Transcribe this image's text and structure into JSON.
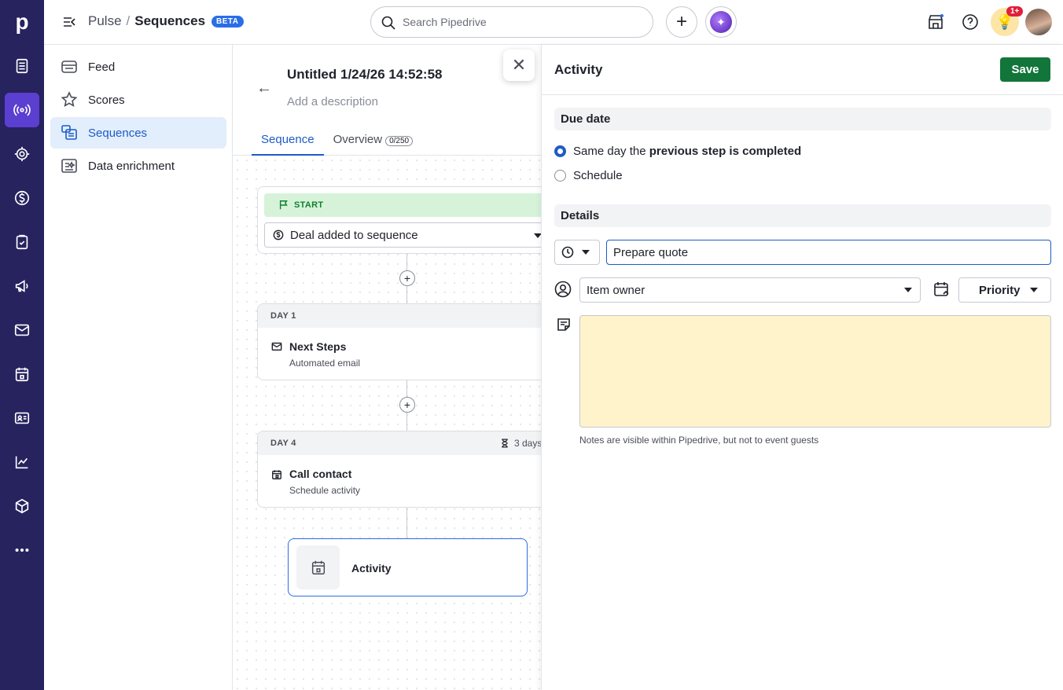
{
  "rail": {
    "logo": "p",
    "items": [
      "deals-list",
      "pulse",
      "leads",
      "deals",
      "tasks",
      "campaigns",
      "mail",
      "calendar",
      "contacts",
      "insights",
      "products",
      "more"
    ]
  },
  "header": {
    "breadcrumb_parent": "Pulse",
    "breadcrumb_sep": "/",
    "breadcrumb_current": "Sequences",
    "beta_badge": "BETA",
    "search_placeholder": "Search Pipedrive",
    "notification_count": "1+"
  },
  "leftnav": {
    "items": [
      {
        "label": "Feed"
      },
      {
        "label": "Scores"
      },
      {
        "label": "Sequences"
      },
      {
        "label": "Data enrichment"
      }
    ]
  },
  "sequence": {
    "title": "Untitled 1/24/26 14:52:58",
    "description_placeholder": "Add a description",
    "tabs": [
      {
        "label": "Sequence"
      },
      {
        "label": "Overview",
        "count": "0/250"
      }
    ],
    "start_label": "START",
    "trigger": "Deal added to sequence",
    "steps": [
      {
        "day": "DAY 1",
        "title": "Next Steps",
        "subtitle": "Automated email"
      },
      {
        "day": "DAY 4",
        "wait": "3 days",
        "title": "Call contact",
        "subtitle": "Schedule activity"
      }
    ],
    "new_step_label": "Activity"
  },
  "panel": {
    "title": "Activity",
    "save_label": "Save",
    "due_date_heading": "Due date",
    "option_same_day_prefix": "Same day the ",
    "option_same_day_bold": "previous step is completed",
    "option_schedule": "Schedule",
    "details_heading": "Details",
    "subject_value": "Prepare quote",
    "owner_value": "Item owner",
    "priority_label": "Priority",
    "notes_hint": "Notes are visible within Pipedrive, but not to event guests"
  },
  "colors": {
    "rail": "#26235f",
    "rail_active": "#5b3fd0",
    "accent_blue": "#1d5bc7",
    "save_green": "#12753a",
    "notes_bg": "#fff3cc",
    "start_bg": "#d6f3d9"
  }
}
